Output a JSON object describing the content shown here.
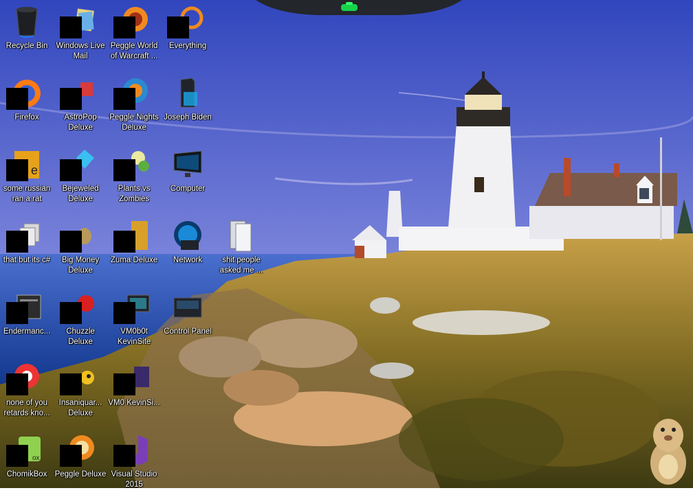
{
  "desktop": {
    "icons": [
      {
        "label": "Recycle Bin",
        "icon": "recycle-bin-icon",
        "redacted": false
      },
      {
        "label": "Windows Live Mail",
        "icon": "mail-icon",
        "redacted": true
      },
      {
        "label": "Peggle World of Warcraft ...",
        "icon": "peggle-icon",
        "redacted": true
      },
      {
        "label": "Everything",
        "icon": "search-icon",
        "redacted": true
      },
      {
        "label": "Firefox",
        "icon": "firefox-icon",
        "redacted": true
      },
      {
        "label": "AstroPop Deluxe",
        "icon": "game-icon",
        "redacted": true
      },
      {
        "label": "Peggle Nights Deluxe",
        "icon": "peggle-icon",
        "redacted": true
      },
      {
        "label": "Joseph Biden",
        "icon": "user-folder-icon",
        "redacted": false
      },
      {
        "label": "some russian ran a rat",
        "icon": "java-icon",
        "redacted": true
      },
      {
        "label": "Bejeweled Deluxe",
        "icon": "gem-icon",
        "redacted": true
      },
      {
        "label": "Plants vs Zombies",
        "icon": "plant-icon",
        "redacted": true
      },
      {
        "label": "Computer",
        "icon": "computer-icon",
        "redacted": false
      },
      {
        "label": "that but its c#",
        "icon": "files-icon",
        "redacted": true
      },
      {
        "label": "Big Money Deluxe",
        "icon": "money-bag-icon",
        "redacted": true
      },
      {
        "label": "Zuma Deluxe",
        "icon": "zuma-icon",
        "redacted": true
      },
      {
        "label": "Network",
        "icon": "network-icon",
        "redacted": false
      },
      {
        "label": "shit people asked me ...",
        "icon": "folder-icon",
        "redacted": false
      },
      {
        "label": "Endermanc...",
        "icon": "window-icon",
        "redacted": true
      },
      {
        "label": "Chuzzle Deluxe",
        "icon": "chuzzle-icon",
        "redacted": true
      },
      {
        "label": "VM0b0t KevinSite",
        "icon": "monitor-icon",
        "redacted": true
      },
      {
        "label": "Control Panel",
        "icon": "control-panel-icon",
        "redacted": false
      },
      {
        "label": "none of you retards kno...",
        "icon": "chrome-icon",
        "redacted": true
      },
      {
        "label": "Insaniquar... Deluxe",
        "icon": "insaniquarium-icon",
        "redacted": true
      },
      {
        "label": "VM0 KevinSi...",
        "icon": "monitor-icon",
        "redacted": true
      },
      {
        "label": "ChomikBox",
        "icon": "chomikbox-icon",
        "redacted": true
      },
      {
        "label": "Peggle Deluxe",
        "icon": "peggle-icon",
        "redacted": true
      },
      {
        "label": "Visual Studio 2015",
        "icon": "visual-studio-icon",
        "redacted": true
      }
    ]
  },
  "colors": {
    "sky_top": "#3a52c0",
    "sky_bottom": "#9aa6e6",
    "sea": "#1e4aa8",
    "grass": "#7a6a22",
    "label_text": "#ffffff"
  }
}
